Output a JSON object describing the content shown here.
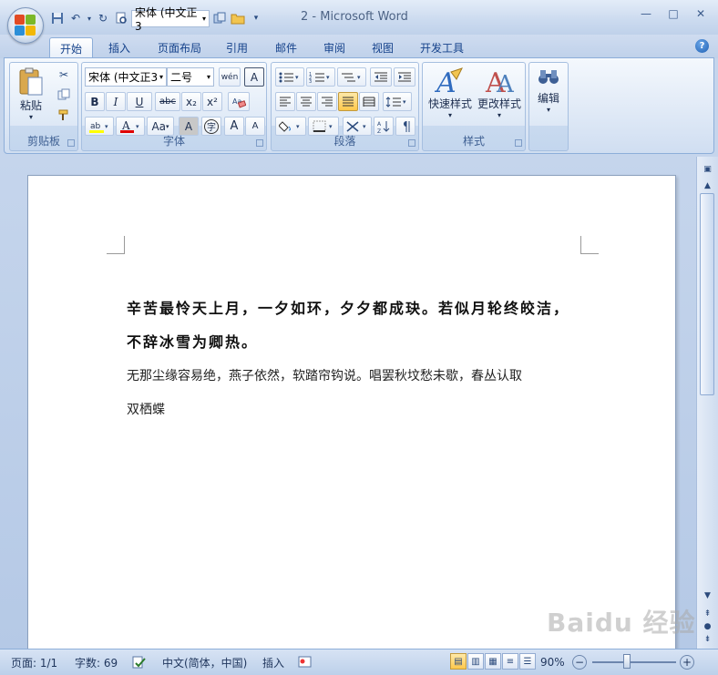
{
  "title": "2 - Microsoft Word",
  "quick_access": {
    "font_value": "宋体 (中文正3"
  },
  "tabs": [
    "开始",
    "插入",
    "页面布局",
    "引用",
    "邮件",
    "审阅",
    "视图",
    "开发工具"
  ],
  "ribbon": {
    "clipboard": {
      "label": "剪贴板",
      "paste": "粘贴"
    },
    "font": {
      "label": "字体",
      "font_name": "宋体 (中文正3",
      "font_size": "二号",
      "wen": "wén",
      "bold": "B",
      "italic": "I",
      "underline": "U",
      "strike": "abc",
      "subscript": "x₂",
      "superscript": "x²",
      "font_color": "A",
      "case": "Aa",
      "char_shade": "A",
      "enclose": "字",
      "grow": "A",
      "shrink": "A"
    },
    "paragraph": {
      "label": "段落"
    },
    "styles": {
      "label": "样式",
      "quick_styles": "快速样式",
      "change_styles": "更改样式"
    },
    "editing": {
      "label": "编辑"
    }
  },
  "document": {
    "lines": [
      "辛苦最怜天上月，一夕如环，夕夕都成玦。若似月轮终皎洁，",
      "不辞冰雪为卿热。",
      "无那尘缘容易绝，燕子依然，软踏帘钩说。唱罢秋坟愁未歇，春丛认取",
      "双栖蝶"
    ]
  },
  "status": {
    "page": "页面: 1/1",
    "words": "字数: 69",
    "language": "中文(简体，中国)",
    "insert": "插入",
    "zoom": "90%"
  },
  "watermark": "Baidu 经验"
}
